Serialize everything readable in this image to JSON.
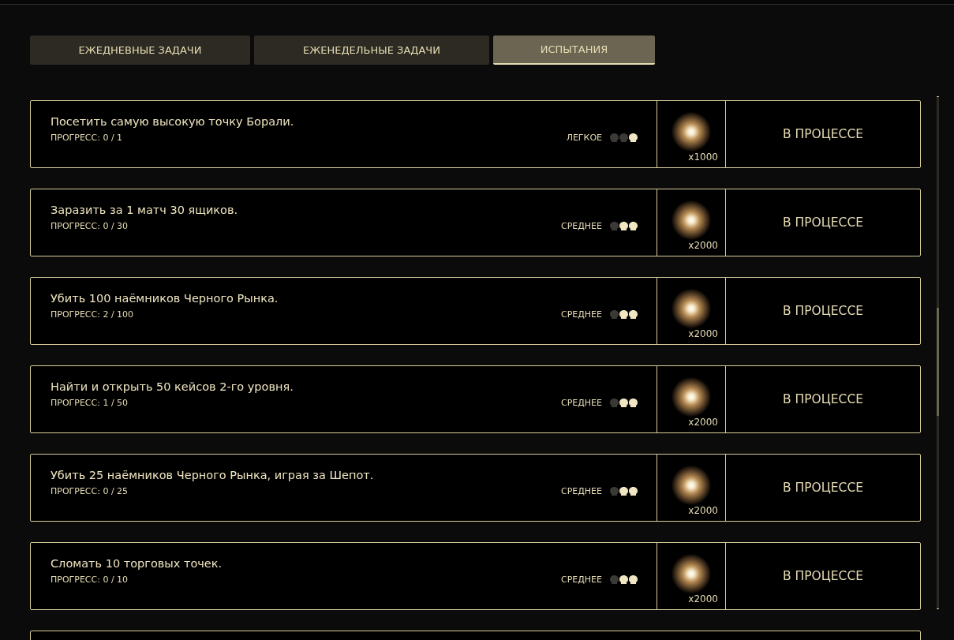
{
  "tabs": [
    {
      "label": "ЕЖЕДНЕВНЫЕ ЗАДАЧИ",
      "selected": false
    },
    {
      "label": "ЕЖЕНЕДЕЛЬНЫЕ ЗАДАЧИ",
      "selected": false
    },
    {
      "label": "ИСПЫТАНИЯ",
      "selected": true
    }
  ],
  "challenges": [
    {
      "title": "Посетить самую высокую точку Борали.",
      "progress": "ПРОГРЕСС: 0 / 1",
      "difficulty": "ЛЕГКОЕ",
      "stars": 1,
      "reward": "x1000",
      "status": "В ПРОЦЕССЕ"
    },
    {
      "title": "Заразить за 1 матч 30 ящиков.",
      "progress": "ПРОГРЕСС: 0 / 30",
      "difficulty": "СРЕДНЕЕ",
      "stars": 2,
      "reward": "x2000",
      "status": "В ПРОЦЕССЕ"
    },
    {
      "title": "Убить 100 наёмников Черного Рынка.",
      "progress": "ПРОГРЕСС: 2 / 100",
      "difficulty": "СРЕДНЕЕ",
      "stars": 2,
      "reward": "x2000",
      "status": "В ПРОЦЕССЕ"
    },
    {
      "title": "Найти и открыть 50 кейсов 2-го уровня.",
      "progress": "ПРОГРЕСС: 1 / 50",
      "difficulty": "СРЕДНЕЕ",
      "stars": 2,
      "reward": "x2000",
      "status": "В ПРОЦЕССЕ"
    },
    {
      "title": "Убить 25 наёмников Черного Рынка, играя за Шепот.",
      "progress": "ПРОГРЕСС: 0 / 25",
      "difficulty": "СРЕДНЕЕ",
      "stars": 2,
      "reward": "x2000",
      "status": "В ПРОЦЕССЕ"
    },
    {
      "title": "Сломать 10 торговых точек.",
      "progress": "ПРОГРЕСС: 0 / 10",
      "difficulty": "СРЕДНЕЕ",
      "stars": 2,
      "reward": "x2000",
      "status": "В ПРОЦЕССЕ"
    }
  ]
}
